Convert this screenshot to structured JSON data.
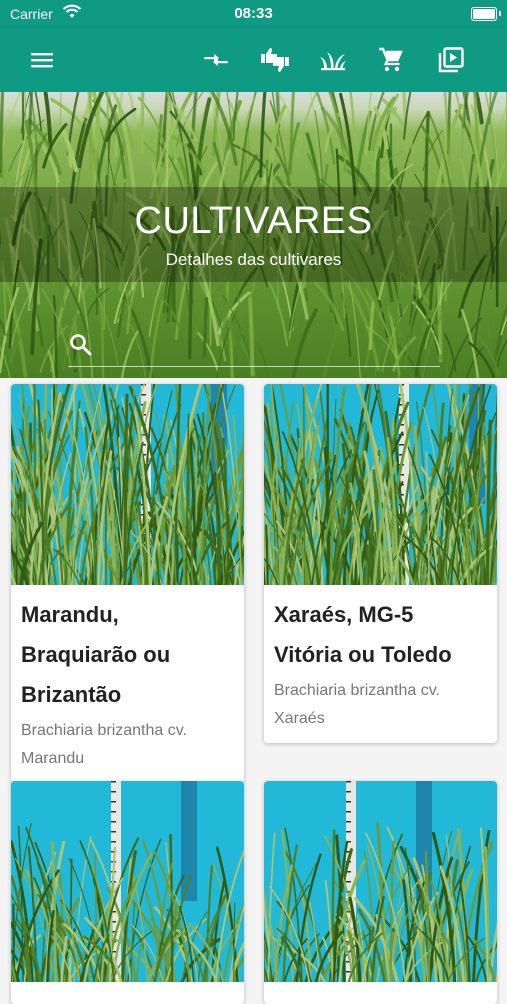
{
  "status_bar": {
    "carrier": "Carrier",
    "time": "08:33"
  },
  "app_bar": {
    "icons": [
      "menu-icon",
      "compare-arrows-icon",
      "thumbs-up-down-icon",
      "grass-icon",
      "shopping-cart-icon",
      "video-library-icon"
    ]
  },
  "hero": {
    "title": "CULTIVARES",
    "subtitle": "Detalhes das cultivares",
    "search_placeholder": ""
  },
  "cards": [
    {
      "name": "Marandu, Braquiarão ou Brizantão",
      "scientific": "Brachiaria brizantha cv. Marandu"
    },
    {
      "name": "Xaraés, MG-5 Vitória ou Toledo",
      "scientific": "Brachiaria brizantha cv. Xaraés"
    },
    {
      "name": "",
      "scientific": ""
    },
    {
      "name": "",
      "scientific": ""
    }
  ],
  "colors": {
    "primary": "#0e9a83",
    "sky": "#22b8d8",
    "grass": "#5c8f2e"
  }
}
